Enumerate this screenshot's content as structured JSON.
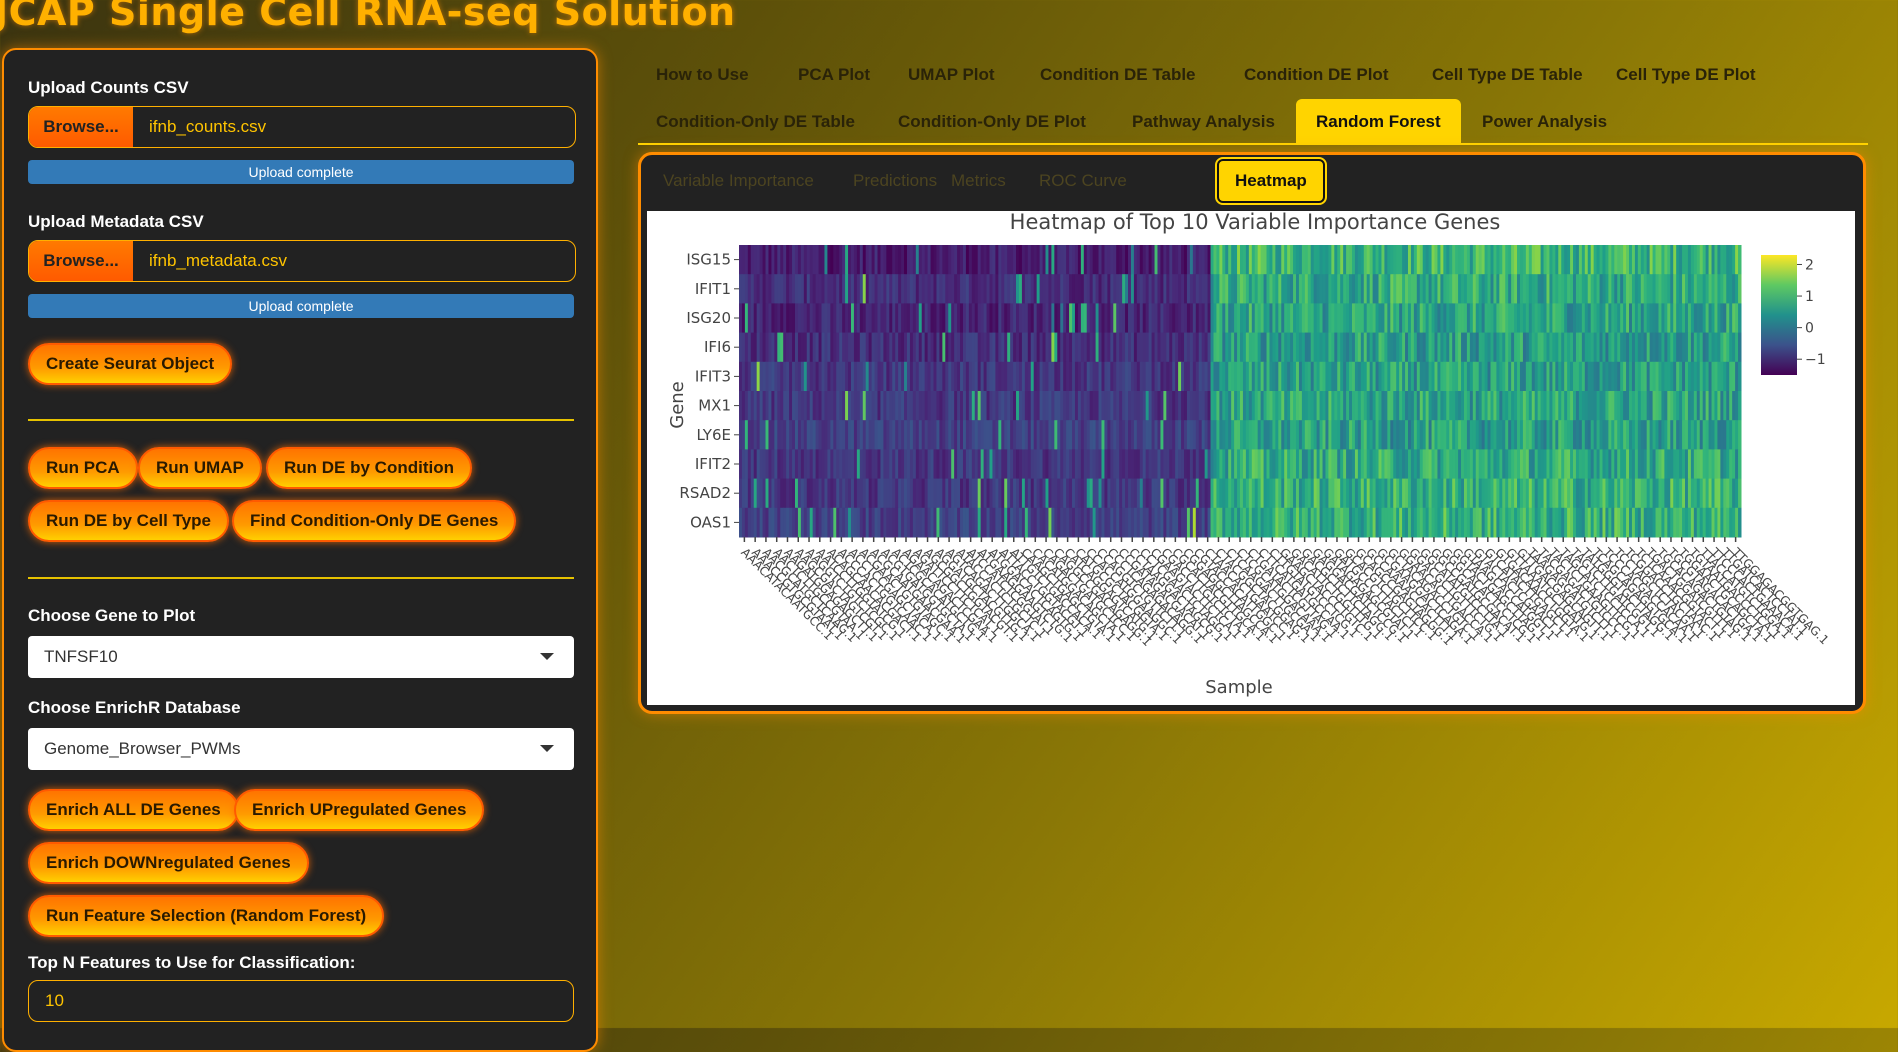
{
  "app_title": "JCAP Single Cell RNA-seq Solution",
  "sidebar": {
    "counts_label": "Upload Counts CSV",
    "counts_browse": "Browse...",
    "counts_file": "ifnb_counts.csv",
    "counts_status": "Upload complete",
    "meta_label": "Upload Metadata CSV",
    "meta_browse": "Browse...",
    "meta_file": "ifnb_metadata.csv",
    "meta_status": "Upload complete",
    "create_seurat": "Create Seurat Object",
    "run_pca": "Run PCA",
    "run_umap": "Run UMAP",
    "run_de_condition": "Run DE by Condition",
    "run_de_celltype": "Run DE by Cell Type",
    "find_condition_only": "Find Condition-Only DE Genes",
    "gene_label": "Choose Gene to Plot",
    "gene_value": "TNFSF10",
    "enrichr_label": "Choose EnrichR Database",
    "enrichr_value": "Genome_Browser_PWMs",
    "enrich_all": "Enrich ALL DE Genes",
    "enrich_up": "Enrich UPregulated Genes",
    "enrich_down": "Enrich DOWNregulated Genes",
    "run_feature_selection": "Run Feature Selection (Random Forest)",
    "topn_label": "Top N Features to Use for Classification:",
    "topn_value": "10"
  },
  "tabs": {
    "row1": [
      "How to Use",
      "PCA Plot",
      "UMAP Plot",
      "Condition DE Table",
      "Condition DE Plot",
      "Cell Type DE Table",
      "Cell Type DE Plot"
    ],
    "row2": [
      "Condition-Only DE Table",
      "Condition-Only DE Plot",
      "Pathway Analysis",
      "Random Forest",
      "Power Analysis"
    ],
    "active": "Random Forest"
  },
  "subtabs": {
    "items": [
      "Variable Importance",
      "Predictions",
      "Metrics",
      "ROC Curve",
      "Heatmap"
    ],
    "active": "Heatmap"
  },
  "chart_data": {
    "type": "heatmap",
    "title": "Heatmap of Top 10 Variable Importance Genes",
    "xlabel": "Sample",
    "ylabel": "Gene",
    "genes": [
      "ISG15",
      "IFIT1",
      "ISG20",
      "IFI6",
      "IFIT3",
      "MX1",
      "LY6E",
      "IFIT2",
      "RSAD2",
      "OAS1"
    ],
    "colorscale": "viridis",
    "zlim": [
      -1.5,
      2.3
    ],
    "colorbar_ticks": [
      2,
      1,
      0,
      -1
    ],
    "group_split_fraction": 0.47,
    "group_means": {
      "left": [
        -1.2,
        -1.0,
        -1.1,
        -1.0,
        -0.9,
        -0.9,
        -0.8,
        -0.9,
        -0.9,
        -0.8
      ],
      "right": [
        1.0,
        0.8,
        0.7,
        0.6,
        0.6,
        0.7,
        0.6,
        0.8,
        0.9,
        0.9
      ]
    },
    "sample_tick_labels": [
      "AAACATACAATGCC.1",
      "AAACCGTGCGTAAT.1",
      "AACGCATGCTCAAG.1",
      "AACTCTTGCCGTAA.1",
      "AAGATGGAGAGCTT.1",
      "AAGCGACTAGTCGT.1",
      "AAGGTCTGTCTCGC.1",
      "AATCCTTGGTATCG.1",
      "ACAGCAACACGACT.1",
      "ACCCACTGGTCAAC.1",
      "ACCTCCGAGCTACA.1",
      "ACGAACTGTGTAGC.1",
      "ACGCAATGAACGAA.1",
      "ACGTGATGGTGCTA.1",
      "ACTCGCACATGCTG.1",
      "AGAACAGACTCGAA.1",
      "AGATTCCTTCTCAT.1",
      "AGCGGCTGGTACGT.1",
      "AGGATGCTACGTTG.1",
      "AGTCAGACTTGGCA.1",
      "ATACCACTCTGCTC.1",
      "ATCCATCTCGGTAT.1",
      "ATGAAGGAAGTCTG.1",
      "ATGGACACTCAGTG.1",
      "ATTACCTGGTACGT.1",
      "ATTGTCTGACCACA.1",
      "CAAGCTGAGCTGTA.1",
      "CACATGGACAGCTA.1",
      "CAGACTGATGCTCC.1",
      "CAGGCCGACAGAGG.1",
      "CATCAGGAGTCATG.1",
      "CATGCGCTACGGTA.1",
      "CCACCATGGAAGGC.1",
      "CCAGGTCTGTTCTT.1",
      "CCCTCAGAGACAGG.1",
      "CCGATAGACGACAT.1",
      "CCTAAGGACTAGCG.1",
      "CCTCGAACTCTAGG.1",
      "CGAAGTACTTCTCA.1",
      "CGACCTTGTCTCTA.1",
      "CGCACTACGTTGCA.1",
      "CGGAGGCTTAGCCA.1",
      "CGTACCACATTGGC.1",
      "CTAACACTGAATCC.1",
      "CTACGGCTACGGAG.1",
      "CTCAAGACTTGCGA.1",
      "CTCGCATGGACAAA.1",
      "CTGATACTCGTTAG.1",
      "CTTCATGATGCCAA.1",
      "CTTGTATGTCCTCG.1",
      "GAAGCTACCCTGTC.1",
      "GACATTCTGGTTTG.1",
      "GACGCTCTTCTAGG.1",
      "GAGGACGATCTCCG.1",
      "GATAGAGAGCGTAT.1",
      "GATGCCCTTACTCT.1",
      "GCACGTCTGCTTCC.1",
      "GCAGCCGAGTAGGG.1",
      "GCCAAAACCACTTT.1",
      "GCGAAGGACTCAGA.1",
      "GCTACAGACCTGTC.1",
      "GGAACACTTGACCA.1",
      "GGACGCTGTTTCTG.1",
      "GGCATATGTCCTTA.1",
      "GGCCGATGCGACAT.1",
      "GGGCACACTCCTCG.1",
      "GGTACTGAGCTTAG.1",
      "GTAAGCACCATGGT.1",
      "GTACTACTCGAACT.1",
      "GTCATACTTGAGCT.1",
      "GTGACAACCTGGTA.1",
      "GTTAAATGCTGATG.1",
      "GTTGACGAGCAGTT.1",
      "TAAGAGGATGTCTT.1",
      "TACGAGACTGTCCC.1",
      "TACTCTGAAGTTCG.1",
      "TAGCATCTCCTCCA.1",
      "TAGTCTTGATCGGT.1",
      "TATGGGTGCTTAGG.1",
      "TCAGCAGAGGTGCA.1",
      "TCCCACGACCACAA.1",
      "TCCTAGCTCTACGA.1",
      "TCGGACCTGCTAAC.1",
      "TCTCAAACGGTACT.1",
      "TGACTGGATCGTTT.1",
      "TGCACAGACTGTAG.1",
      "TGCGTAGACACTGA.1",
      "TGGAACTGCAGCTA.1",
      "TGTAATGACCCTCA.1",
      "TTACCATGTCTGGA.1",
      "TTCCCACTGAAACA.1",
      "TTGATCACTCCTAT.1",
      "TTGGAGACGGTGAG.1"
    ]
  },
  "colors": {
    "accent": "#ff8c00",
    "title": "#ffb000",
    "active_tab": "#ffd400",
    "progress": "#337ab7"
  }
}
